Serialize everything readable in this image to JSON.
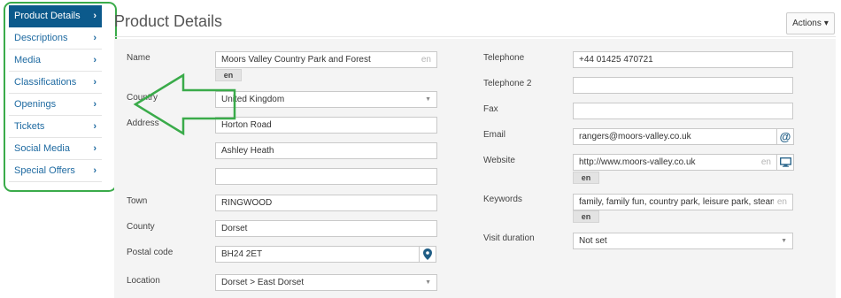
{
  "sidebar": {
    "items": [
      {
        "label": "Product Details"
      },
      {
        "label": "Descriptions"
      },
      {
        "label": "Media"
      },
      {
        "label": "Classifications"
      },
      {
        "label": "Openings"
      },
      {
        "label": "Tickets"
      },
      {
        "label": "Social Media"
      },
      {
        "label": "Special Offers"
      }
    ],
    "chevron": "›"
  },
  "header": {
    "title": "Product Details",
    "actions_label": "Actions",
    "actions_caret": "▾"
  },
  "form": {
    "name": {
      "label": "Name",
      "value": "Moors Valley Country Park and Forest",
      "lang": "en",
      "tag": "en"
    },
    "country": {
      "label": "Country",
      "value": "United Kingdom",
      "caret": "▼"
    },
    "address": {
      "label": "Address",
      "line1": "Horton Road",
      "line2": "Ashley Heath",
      "line3": ""
    },
    "town": {
      "label": "Town",
      "value": "RINGWOOD"
    },
    "county": {
      "label": "County",
      "value": "Dorset"
    },
    "postal_code": {
      "label": "Postal code",
      "value": "BH24 2ET"
    },
    "location": {
      "label": "Location",
      "value": "Dorset > East Dorset",
      "caret": "▼"
    },
    "telephone": {
      "label": "Telephone",
      "value": "+44 01425 470721"
    },
    "telephone2": {
      "label": "Telephone 2",
      "value": ""
    },
    "fax": {
      "label": "Fax",
      "value": ""
    },
    "email": {
      "label": "Email",
      "value": "rangers@moors-valley.co.uk",
      "addon": "@"
    },
    "website": {
      "label": "Website",
      "value": "http://www.moors-valley.co.uk",
      "lang": "en",
      "tag": "en"
    },
    "keywords": {
      "label": "Keywords",
      "value": "family, family fun, country park, leisure park, steam rai",
      "lang": "en",
      "tag": "en"
    },
    "visit_duration": {
      "label": "Visit duration",
      "value": "Not set",
      "caret": "▼"
    }
  },
  "colors": {
    "active_nav": "#0c5a8c",
    "link": "#1e6aa1",
    "annotation": "#3aab4a"
  },
  "icons": {
    "map_pin": "map-pin-icon",
    "email": "at-icon",
    "website": "monitor-icon"
  }
}
